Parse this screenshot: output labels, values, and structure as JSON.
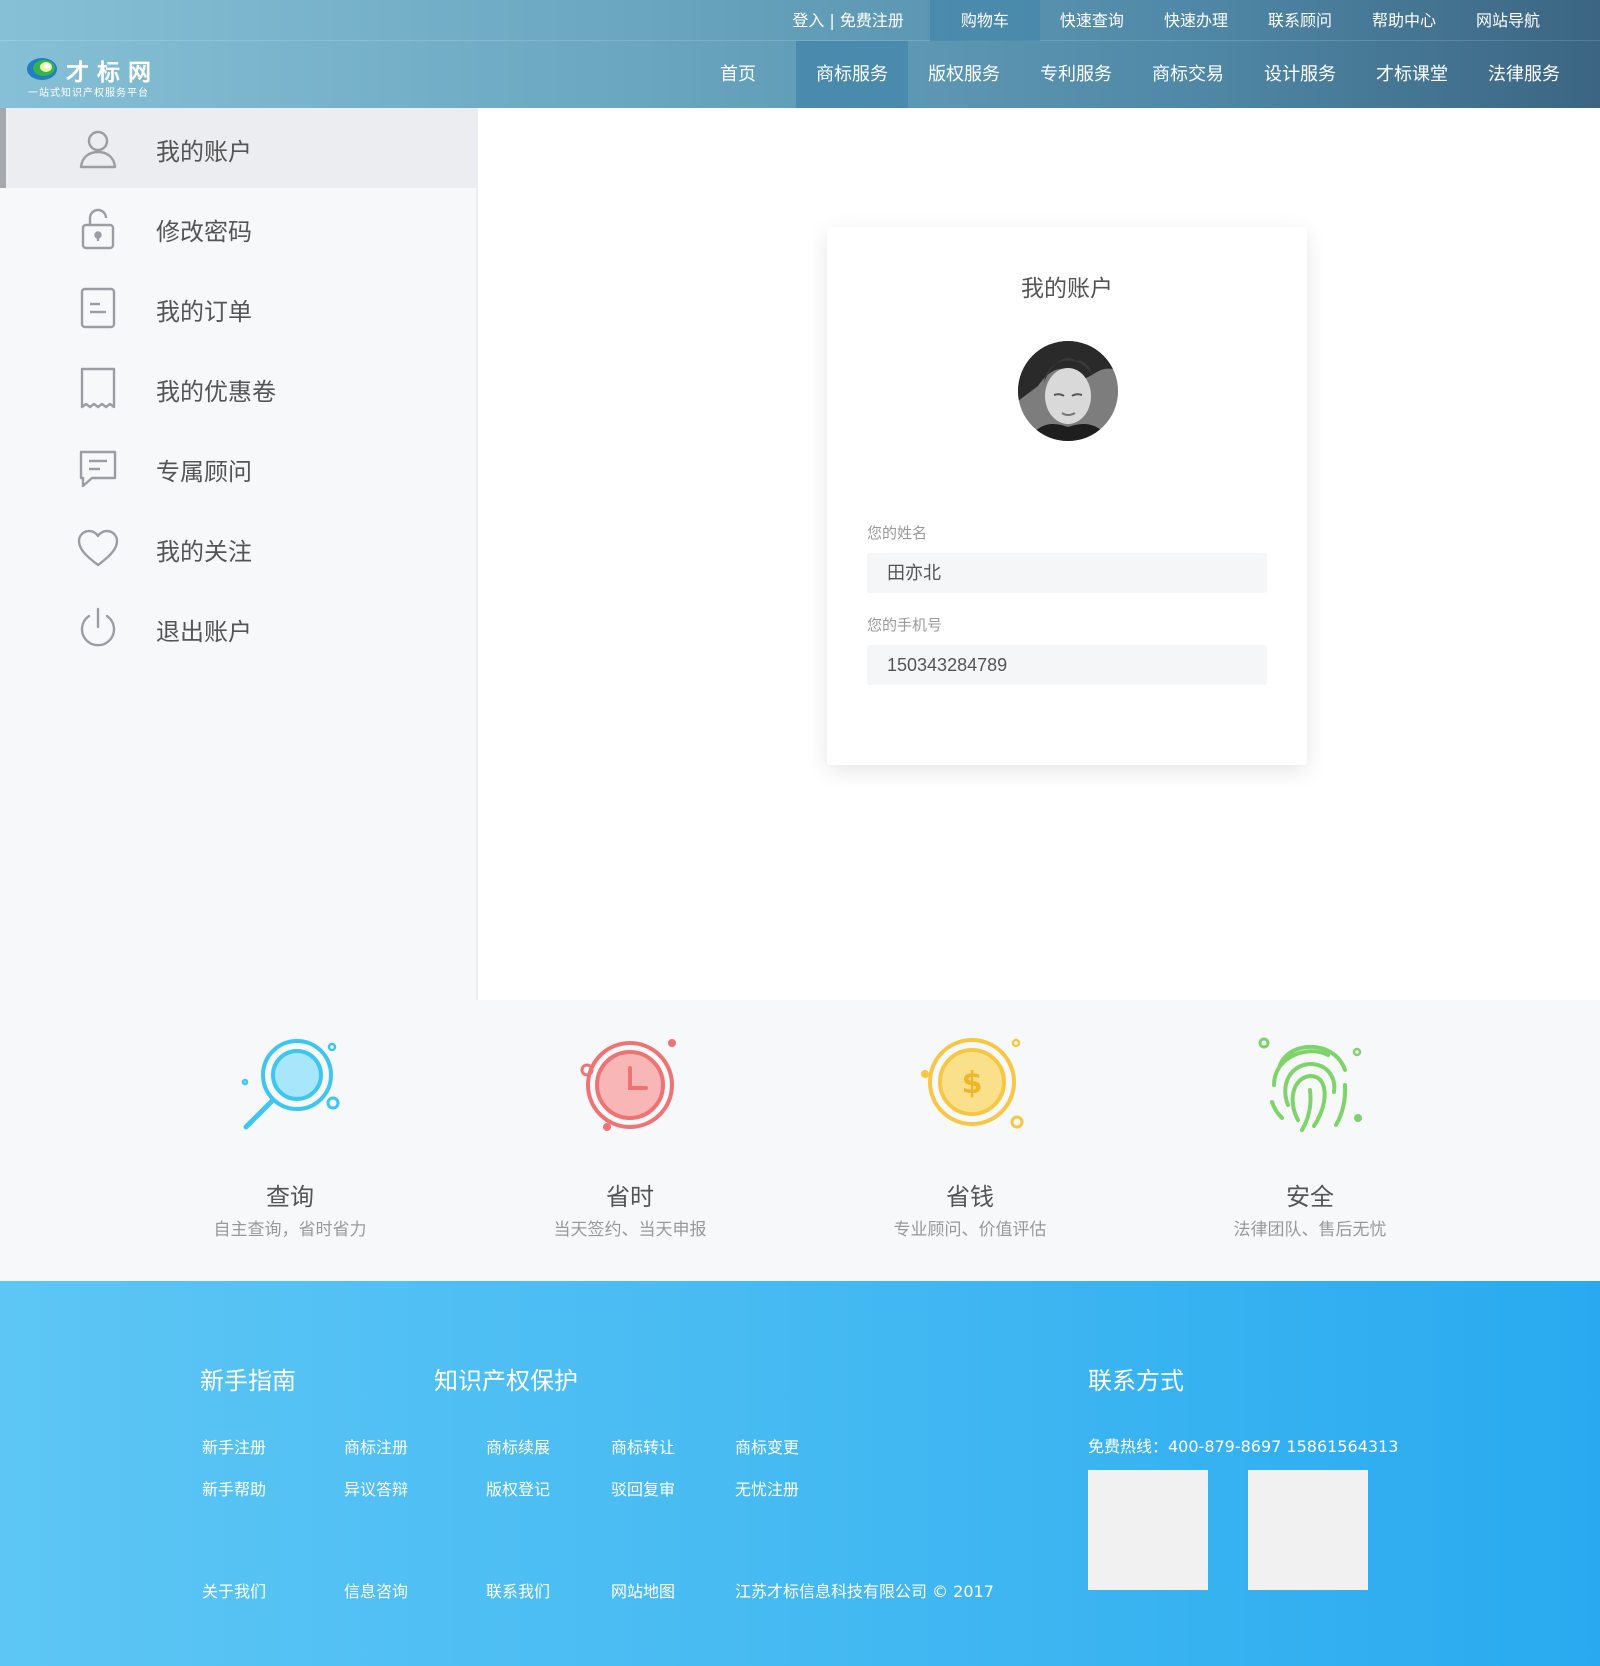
{
  "header": {
    "logo": {
      "title": "才标网",
      "subtitle": "一站式知识产权服务平台"
    },
    "top_links": [
      {
        "label": "登入 | 免费注册"
      },
      {
        "label": "购物车"
      },
      {
        "label": "快速查询"
      },
      {
        "label": "快速办理"
      },
      {
        "label": "联系顾问"
      },
      {
        "label": "帮助中心"
      },
      {
        "label": "网站导航"
      }
    ],
    "nav": [
      {
        "label": "首页"
      },
      {
        "label": "商标服务"
      },
      {
        "label": "版权服务"
      },
      {
        "label": "专利服务"
      },
      {
        "label": "商标交易"
      },
      {
        "label": "设计服务"
      },
      {
        "label": "才标课堂"
      },
      {
        "label": "法律服务"
      }
    ],
    "active_top": "购物车",
    "active_nav": "商标服务"
  },
  "sidebar": {
    "active": "我的账户",
    "items": [
      {
        "label": "我的账户",
        "icon": "user-icon"
      },
      {
        "label": "修改密码",
        "icon": "lock-icon"
      },
      {
        "label": "我的订单",
        "icon": "order-icon"
      },
      {
        "label": "我的优惠卷",
        "icon": "coupon-icon"
      },
      {
        "label": "专属顾问",
        "icon": "chat-icon"
      },
      {
        "label": "我的关注",
        "icon": "heart-icon"
      },
      {
        "label": "退出账户",
        "icon": "power-icon"
      }
    ]
  },
  "account": {
    "title": "我的账户",
    "name_label": "您的姓名",
    "name_value": "田亦北",
    "phone_label": "您的手机号",
    "phone_value": "150343284789"
  },
  "features": [
    {
      "title": "查询",
      "desc": "自主查询，省时省力",
      "icon": "search-icon",
      "color": "#3ec6f0"
    },
    {
      "title": "省时",
      "desc": "当天签约、当天申报",
      "icon": "clock-icon",
      "color": "#f07373"
    },
    {
      "title": "省钱",
      "desc": "专业顾问、价值评估",
      "icon": "coin-icon",
      "color": "#f7c744"
    },
    {
      "title": "安全",
      "desc": "法律团队、售后无忧",
      "icon": "fingerprint-icon",
      "color": "#7ed36a"
    }
  ],
  "footer": {
    "guide_title": "新手指南",
    "ip_title": "知识产权保护",
    "contact_title": "联系方式",
    "guide_links": [
      "新手注册",
      "新手帮助"
    ],
    "ip_links_row1": [
      "商标注册",
      "商标续展",
      "商标转让",
      "商标变更"
    ],
    "ip_links_row2": [
      "异议答辩",
      "版权登记",
      "驳回复审",
      "无忧注册"
    ],
    "bottom_links": [
      "关于我们",
      "信息咨询",
      "联系我们",
      "网站地图"
    ],
    "copyright": "江苏才标信息科技有限公司 © 2017",
    "hotline": "免费热线：400-879-8697    15861564313"
  },
  "colors": {
    "header_start": "#86c0d6",
    "header_end": "#3b6582",
    "footer_start": "#5dc6f5",
    "footer_end": "#29aaf0",
    "sidebar_bg": "#f7f8fa"
  }
}
